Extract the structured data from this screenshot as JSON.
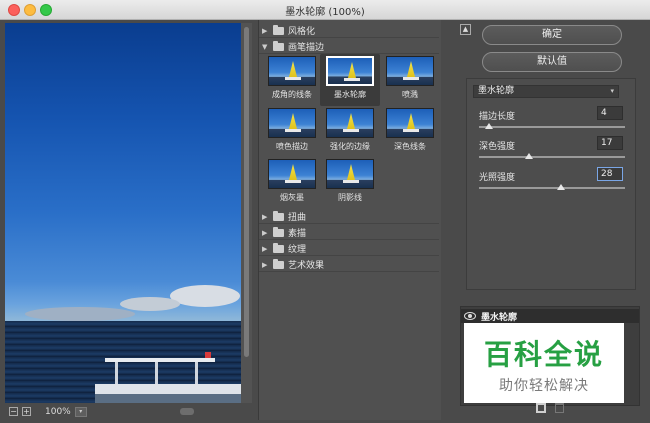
{
  "window": {
    "title": "墨水轮廓 (100%)"
  },
  "preview": {
    "zoom": "100%",
    "zoom_out": "−",
    "zoom_in": "+"
  },
  "gallery": {
    "categories": [
      {
        "label": "风格化",
        "expanded": false
      },
      {
        "label": "画笔描边",
        "expanded": true
      },
      {
        "label": "扭曲",
        "expanded": false
      },
      {
        "label": "素描",
        "expanded": false
      },
      {
        "label": "纹理",
        "expanded": false
      },
      {
        "label": "艺术效果",
        "expanded": false
      }
    ],
    "filters": [
      {
        "label": "成角的线条",
        "selected": false
      },
      {
        "label": "墨水轮廓",
        "selected": true
      },
      {
        "label": "喷溅",
        "selected": false
      },
      {
        "label": "喷色描边",
        "selected": false
      },
      {
        "label": "强化的边缘",
        "selected": false
      },
      {
        "label": "深色线条",
        "selected": false
      },
      {
        "label": "烟灰墨",
        "selected": false
      },
      {
        "label": "阴影线",
        "selected": false
      }
    ]
  },
  "buttons": {
    "ok": "确定",
    "default": "默认值"
  },
  "params": {
    "filter_select": "墨水轮廓",
    "items": [
      {
        "label": "描边长度",
        "value": "4",
        "level": 0.07
      },
      {
        "label": "深色强度",
        "value": "17",
        "level": 0.34
      },
      {
        "label": "光照强度",
        "value": "28",
        "level": 0.56
      }
    ]
  },
  "layers": {
    "active": "墨水轮廓"
  },
  "watermark": {
    "title": "百科全说",
    "subtitle": "助你轻松解决"
  }
}
